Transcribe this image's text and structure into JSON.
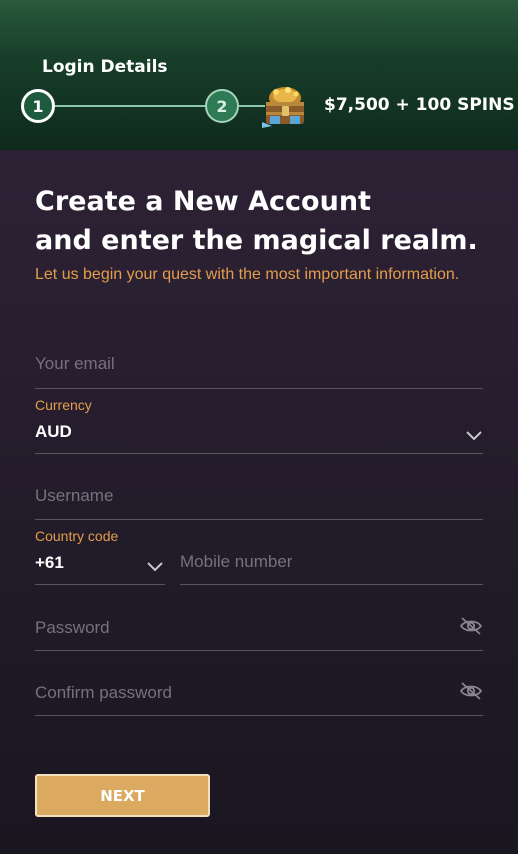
{
  "stepper": {
    "title": "Login Details",
    "step1": "1",
    "step2": "2",
    "bonus": "$7,500 + 100 SPINS"
  },
  "heading": {
    "line1": "Create a New Account",
    "line2": "and enter the magical realm.",
    "subtitle": "Let us begin your quest with the most important information."
  },
  "form": {
    "email_placeholder": "Your email",
    "currency_label": "Currency",
    "currency_value": "AUD",
    "username_placeholder": "Username",
    "country_code_label": "Country code",
    "country_code_value": "+61",
    "mobile_placeholder": "Mobile number",
    "password_placeholder": "Password",
    "confirm_password_placeholder": "Confirm password"
  },
  "actions": {
    "next_label": "NEXT"
  },
  "colors": {
    "accent": "#e39d4b",
    "button": "#dba95f",
    "header_green": "#173d29"
  },
  "icons": [
    "treasure-chest-icon",
    "chevron-down-icon",
    "eye-off-icon"
  ]
}
